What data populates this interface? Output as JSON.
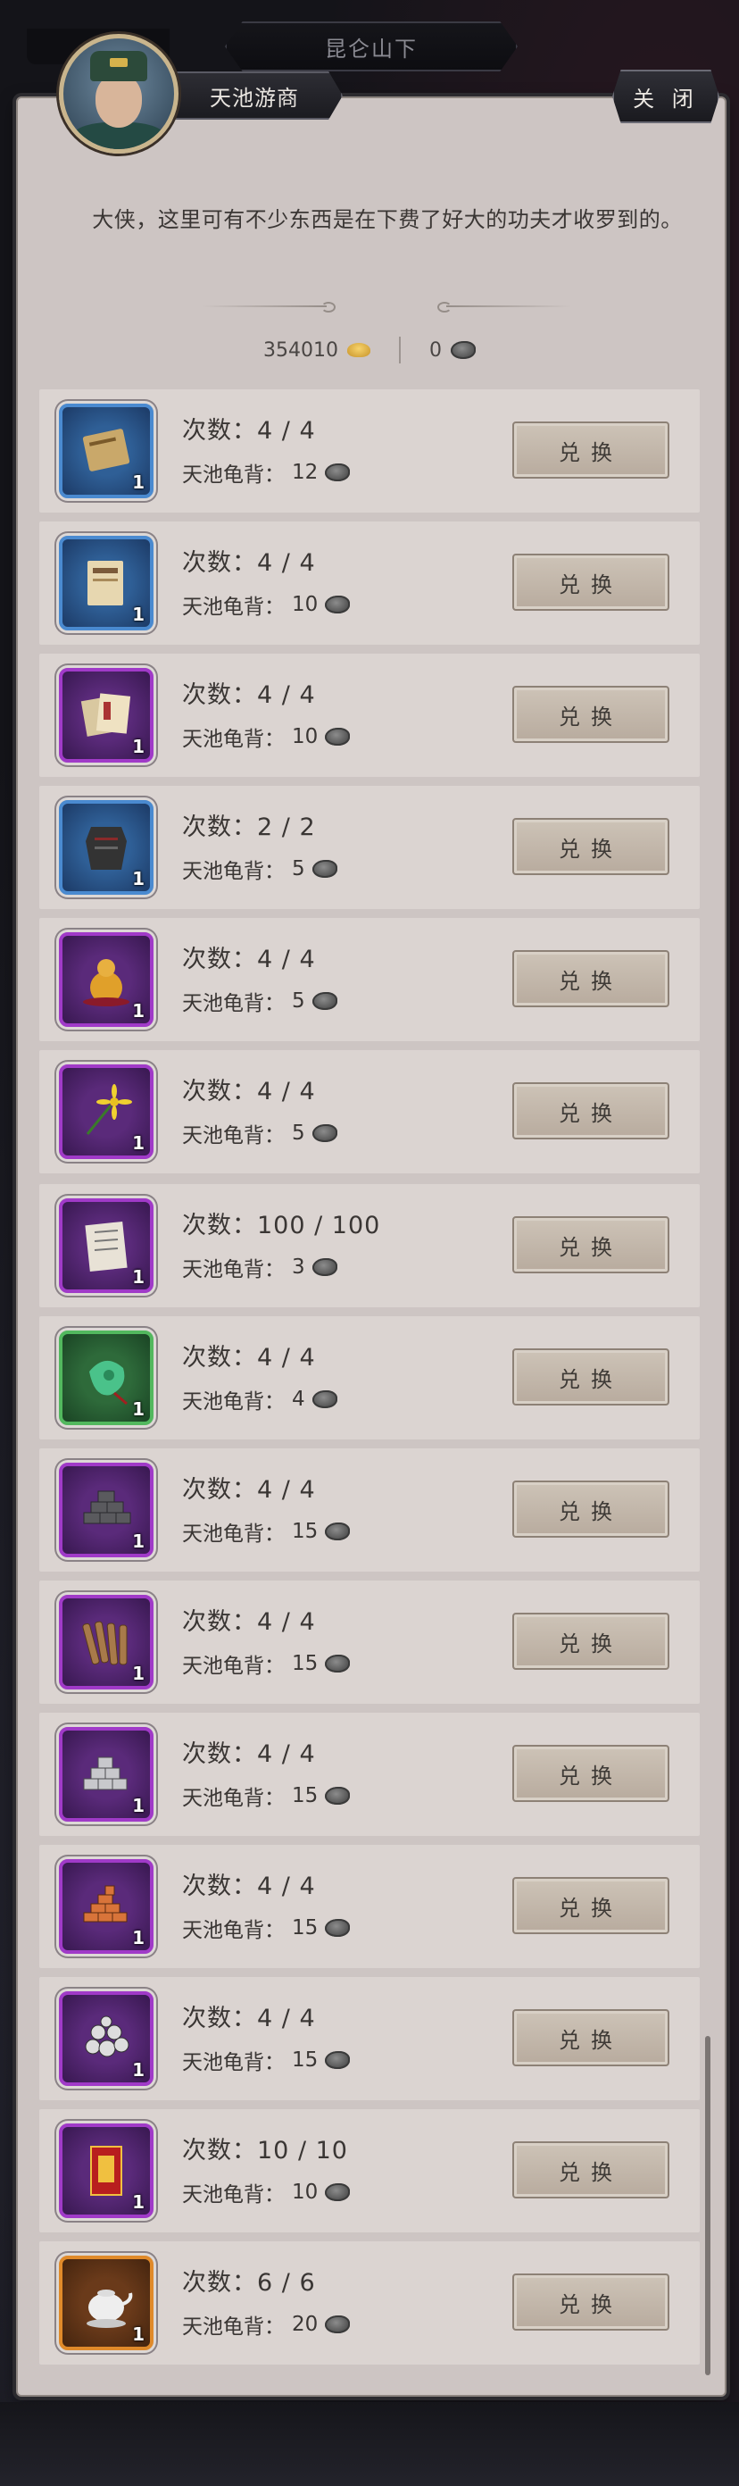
{
  "header": {
    "location": "昆仑山下",
    "npc_name": "天池游商",
    "close_label": "关 闭"
  },
  "dialogue": "大侠，这里可有不少东西是在下费了好大的功夫才收罗到的。",
  "currency": {
    "gold": "354010",
    "shell": "0"
  },
  "cost_label": "天池龟背：",
  "exchange_label": "兑换",
  "items": [
    {
      "count": "次数：4 / 4",
      "cost": "12",
      "qty": "1",
      "rarity": "blue",
      "art": "scroll-tan"
    },
    {
      "count": "次数：4 / 4",
      "cost": "10",
      "qty": "1",
      "rarity": "blue",
      "art": "book"
    },
    {
      "count": "次数：4 / 4",
      "cost": "10",
      "qty": "1",
      "rarity": "purple",
      "art": "books"
    },
    {
      "count": "次数：2 / 2",
      "cost": "5",
      "qty": "1",
      "rarity": "blue",
      "art": "armor"
    },
    {
      "count": "次数：4 / 4",
      "cost": "5",
      "qty": "1",
      "rarity": "purple",
      "art": "gourd"
    },
    {
      "count": "次数：4 / 4",
      "cost": "5",
      "qty": "1",
      "rarity": "purple",
      "art": "flower"
    },
    {
      "count": "次数：100 / 100",
      "cost": "3",
      "qty": "1",
      "rarity": "purple",
      "art": "paper"
    },
    {
      "count": "次数：4 / 4",
      "cost": "4",
      "qty": "1",
      "rarity": "green",
      "art": "jade"
    },
    {
      "count": "次数：4 / 4",
      "cost": "15",
      "qty": "1",
      "rarity": "purple",
      "art": "iron-ingots"
    },
    {
      "count": "次数：4 / 4",
      "cost": "15",
      "qty": "1",
      "rarity": "purple",
      "art": "wood"
    },
    {
      "count": "次数：4 / 4",
      "cost": "15",
      "qty": "1",
      "rarity": "purple",
      "art": "silver-ingots"
    },
    {
      "count": "次数：4 / 4",
      "cost": "15",
      "qty": "1",
      "rarity": "purple",
      "art": "copper-ingots"
    },
    {
      "count": "次数：4 / 4",
      "cost": "15",
      "qty": "1",
      "rarity": "purple",
      "art": "ore"
    },
    {
      "count": "次数：10 / 10",
      "cost": "10",
      "qty": "1",
      "rarity": "purple",
      "art": "red-book"
    },
    {
      "count": "次数：6 / 6",
      "cost": "20",
      "qty": "1",
      "rarity": "orange",
      "art": "teapot"
    }
  ]
}
